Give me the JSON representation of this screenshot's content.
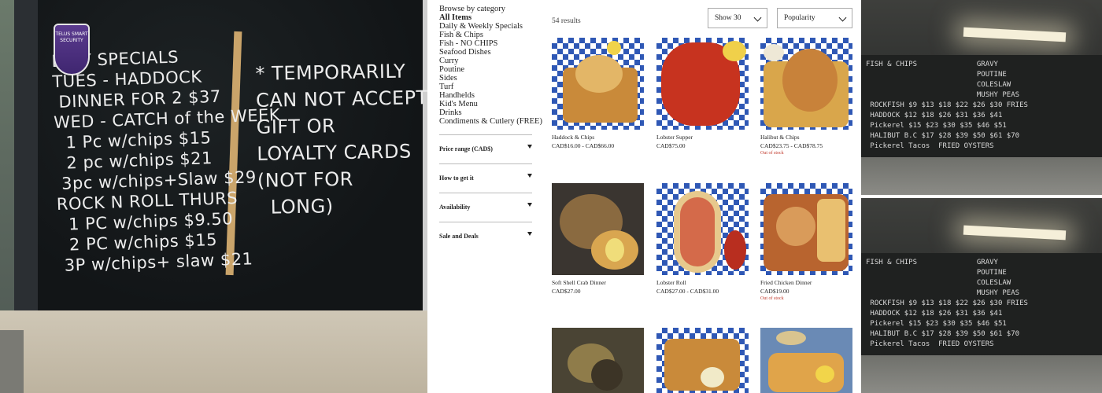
{
  "categories_title": "Browse by category",
  "categories": [
    {
      "label": "All Items",
      "active": true
    },
    {
      "label": "Daily & Weekly Specials"
    },
    {
      "label": "Fish & Chips"
    },
    {
      "label": "Fish - NO CHIPS"
    },
    {
      "label": "Seafood Dishes"
    },
    {
      "label": "Curry"
    },
    {
      "label": "Poutine"
    },
    {
      "label": "Sides"
    },
    {
      "label": "Turf"
    },
    {
      "label": "Handhelds"
    },
    {
      "label": "Kid's Menu"
    },
    {
      "label": "Drinks"
    },
    {
      "label": "Condiments & Cutlery (FREE)"
    }
  ],
  "filters": [
    {
      "label": "Price range (CAD$)"
    },
    {
      "label": "How to get it"
    },
    {
      "label": "Availability"
    },
    {
      "label": "Sale and Deals"
    }
  ],
  "results_count": "54 results",
  "show_select": "Show 30",
  "sort_select": "Popularity",
  "products": [
    {
      "name": "Haddock & Chips",
      "price": "CAD$16.00 - CAD$66.00",
      "stock": ""
    },
    {
      "name": "Lobster Supper",
      "price": "CAD$75.00",
      "stock": ""
    },
    {
      "name": "Halibut & Chips",
      "price": "CAD$23.75 - CAD$78.75",
      "stock": "Out of stock"
    },
    {
      "name": "Soft Shell Crab Dinner",
      "price": "CAD$27.00",
      "stock": ""
    },
    {
      "name": "Lobster Roll",
      "price": "CAD$27.00 - CAD$31.00",
      "stock": ""
    },
    {
      "name": "Fried Chicken Dinner",
      "price": "CAD$19.00",
      "stock": "Out of stock"
    }
  ],
  "left_photo": {
    "badge": "TELUS SMART SECURITY",
    "board_left": "EKLY SPECIALS\nTUES - HADDOCK\n DINNER FOR 2 $37\nWED - CATCH of the WEEK\n  1 Pc w/chips $15\n  2 pc w/chips $21\n 3pc w/chips+Slaw $29\nROCK N ROLL THURS\n  1 PC w/chips $9.50\n  2 PC w/chips $15\n 3P w/chips+ slaw $21",
    "board_right": "* TEMPORARILY\nCAN NOT ACCEPT\nGIFT OR\nLOYALTY CARDS\n(NOT FOR\n  LONG)"
  },
  "right_photo_board": "FISH & CHIPS              GRAVY\n                          POUTINE\n                          COLESLAW\n                          MUSHY PEAS\n ROCKFISH $9 $13 $18 $22 $26 $30 FRIES\n HADDOCK $12 $18 $26 $31 $36 $41\n Pickerel $15 $23 $30 $35 $46 $51\n HALIBUT B.C $17 $28 $39 $50 $61 $70\n Pickerel Tacos  FRIED OYSTERS",
  "colors": {
    "accent_red": "#c0392b",
    "border": "#aaaaaa",
    "checker_blue": "#2f58b5"
  }
}
